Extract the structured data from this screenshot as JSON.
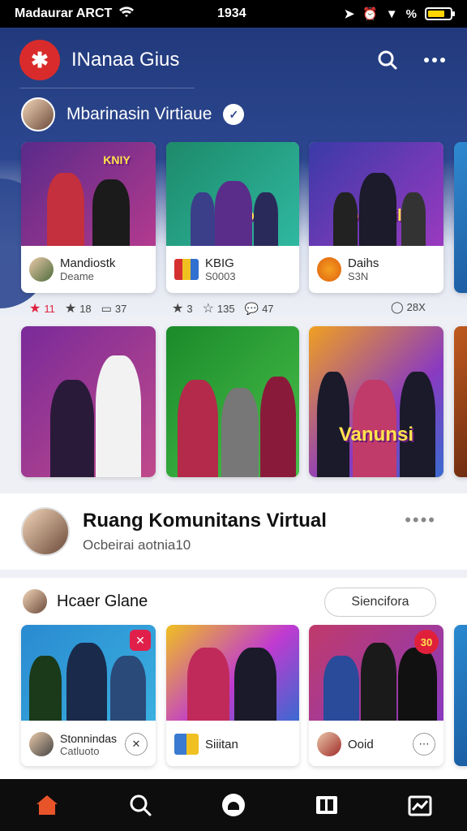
{
  "status_bar": {
    "carrier": "Madaurar ARCT",
    "time": "1934",
    "battery_percent": "%",
    "battery_level": 0.75
  },
  "header": {
    "app_title": "INanaa Gius"
  },
  "profile": {
    "name": "Mbarinasin Virtiaue"
  },
  "row1": [
    {
      "badge": "KNIY",
      "title": "Mandiostk",
      "subtitle": "Deame"
    },
    {
      "badge": "YNDEINORS",
      "title": "KBIG",
      "subtitle": "S0003"
    },
    {
      "badge": "Nomunilis",
      "title": "Daihs",
      "subtitle": "S3N"
    }
  ],
  "stats": [
    {
      "icon": "star-icon",
      "value": "11"
    },
    {
      "icon": "star-outline-icon",
      "value": "18"
    },
    {
      "icon": "chat-icon",
      "value": "37"
    },
    {
      "icon": "star-icon",
      "value": "3"
    },
    {
      "icon": "star-outline-icon",
      "value": "135"
    },
    {
      "icon": "comment-icon",
      "value": "47"
    },
    {
      "icon": "clock-icon",
      "value": "28X"
    }
  ],
  "row2": [
    {
      "badge": ""
    },
    {
      "badge": ""
    },
    {
      "badge": "Vanunsi"
    }
  ],
  "community": {
    "title": "Ruang Komunitans Virtual",
    "subtitle": "Ocbeirai aotnia10",
    "more": "••••"
  },
  "section2": {
    "label": "Hcaer Glane",
    "pill": "Siencifora",
    "cards": [
      {
        "title": "Stonnindas",
        "subtitle": "Catluoto",
        "badge": ""
      },
      {
        "title": "Siiitan",
        "subtitle": "",
        "badge": ""
      },
      {
        "title": "Ooid",
        "subtitle": "",
        "badge": "30"
      }
    ]
  },
  "colors": {
    "brand_red": "#d92b2b",
    "header_blue": "#223a7c",
    "nav_active": "#e8542a"
  }
}
